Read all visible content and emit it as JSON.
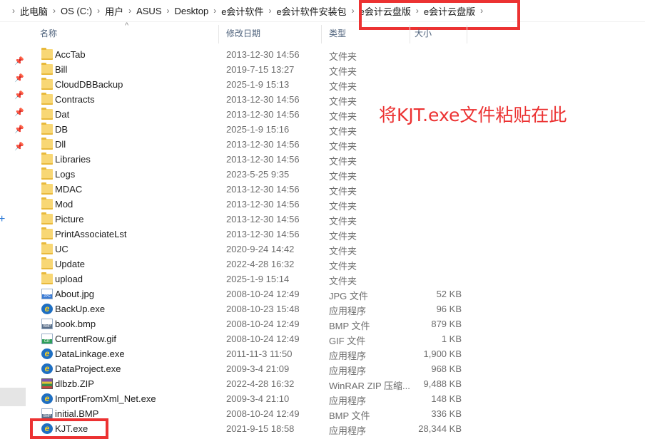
{
  "breadcrumbs": [
    "此电脑",
    "OS (C:)",
    "用户",
    "ASUS",
    "Desktop",
    "e会计软件",
    "e会计软件安装包",
    "e会计云盘版",
    "e会计云盘版"
  ],
  "columns": {
    "name": "名称",
    "date": "修改日期",
    "type": "类型",
    "size": "大小"
  },
  "annotation": "将KJT.exe文件粘贴在此",
  "files": [
    {
      "name": "AccTab",
      "date": "2013-12-30 14:56",
      "type": "文件夹",
      "size": "",
      "icon": "folder-icon"
    },
    {
      "name": "Bill",
      "date": "2019-7-15 13:27",
      "type": "文件夹",
      "size": "",
      "icon": "folder-icon"
    },
    {
      "name": "CloudDBBackup",
      "date": "2025-1-9 15:13",
      "type": "文件夹",
      "size": "",
      "icon": "folder-icon"
    },
    {
      "name": "Contracts",
      "date": "2013-12-30 14:56",
      "type": "文件夹",
      "size": "",
      "icon": "folder-icon"
    },
    {
      "name": "Dat",
      "date": "2013-12-30 14:56",
      "type": "文件夹",
      "size": "",
      "icon": "folder-icon"
    },
    {
      "name": "DB",
      "date": "2025-1-9 15:16",
      "type": "文件夹",
      "size": "",
      "icon": "folder-icon"
    },
    {
      "name": "Dll",
      "date": "2013-12-30 14:56",
      "type": "文件夹",
      "size": "",
      "icon": "folder-icon"
    },
    {
      "name": "Libraries",
      "date": "2013-12-30 14:56",
      "type": "文件夹",
      "size": "",
      "icon": "folder-icon"
    },
    {
      "name": "Logs",
      "date": "2023-5-25 9:35",
      "type": "文件夹",
      "size": "",
      "icon": "folder-icon"
    },
    {
      "name": "MDAC",
      "date": "2013-12-30 14:56",
      "type": "文件夹",
      "size": "",
      "icon": "folder-icon"
    },
    {
      "name": "Mod",
      "date": "2013-12-30 14:56",
      "type": "文件夹",
      "size": "",
      "icon": "folder-icon"
    },
    {
      "name": "Picture",
      "date": "2013-12-30 14:56",
      "type": "文件夹",
      "size": "",
      "icon": "folder-icon"
    },
    {
      "name": "PrintAssociateLst",
      "date": "2013-12-30 14:56",
      "type": "文件夹",
      "size": "",
      "icon": "folder-icon"
    },
    {
      "name": "UC",
      "date": "2020-9-24 14:42",
      "type": "文件夹",
      "size": "",
      "icon": "folder-icon"
    },
    {
      "name": "Update",
      "date": "2022-4-28 16:32",
      "type": "文件夹",
      "size": "",
      "icon": "folder-icon"
    },
    {
      "name": "upload",
      "date": "2025-1-9 15:14",
      "type": "文件夹",
      "size": "",
      "icon": "folder-icon"
    },
    {
      "name": "About.jpg",
      "date": "2008-10-24 12:49",
      "type": "JPG 文件",
      "size": "52 KB",
      "icon": "jpg-file-icon"
    },
    {
      "name": "BackUp.exe",
      "date": "2008-10-23 15:48",
      "type": "应用程序",
      "size": "96 KB",
      "icon": "app-e-icon"
    },
    {
      "name": "book.bmp",
      "date": "2008-10-24 12:49",
      "type": "BMP 文件",
      "size": "879 KB",
      "icon": "bmp-file-icon"
    },
    {
      "name": "CurrentRow.gif",
      "date": "2008-10-24 12:49",
      "type": "GIF 文件",
      "size": "1 KB",
      "icon": "gif-file-icon"
    },
    {
      "name": "DataLinkage.exe",
      "date": "2011-11-3 11:50",
      "type": "应用程序",
      "size": "1,900 KB",
      "icon": "app-e-icon"
    },
    {
      "name": "DataProject.exe",
      "date": "2009-3-4 21:09",
      "type": "应用程序",
      "size": "968 KB",
      "icon": "app-e-icon"
    },
    {
      "name": "dlbzb.ZIP",
      "date": "2022-4-28 16:32",
      "type": "WinRAR ZIP 压缩...",
      "size": "9,488 KB",
      "icon": "zip-file-icon"
    },
    {
      "name": "ImportFromXml_Net.exe",
      "date": "2009-3-4 21:10",
      "type": "应用程序",
      "size": "148 KB",
      "icon": "app-e-icon"
    },
    {
      "name": "initial.BMP",
      "date": "2008-10-24 12:49",
      "type": "BMP 文件",
      "size": "336 KB",
      "icon": "bmp-file-icon"
    },
    {
      "name": "KJT.exe",
      "date": "2021-9-15 18:58",
      "type": "应用程序",
      "size": "28,344 KB",
      "icon": "app-e-icon"
    }
  ]
}
